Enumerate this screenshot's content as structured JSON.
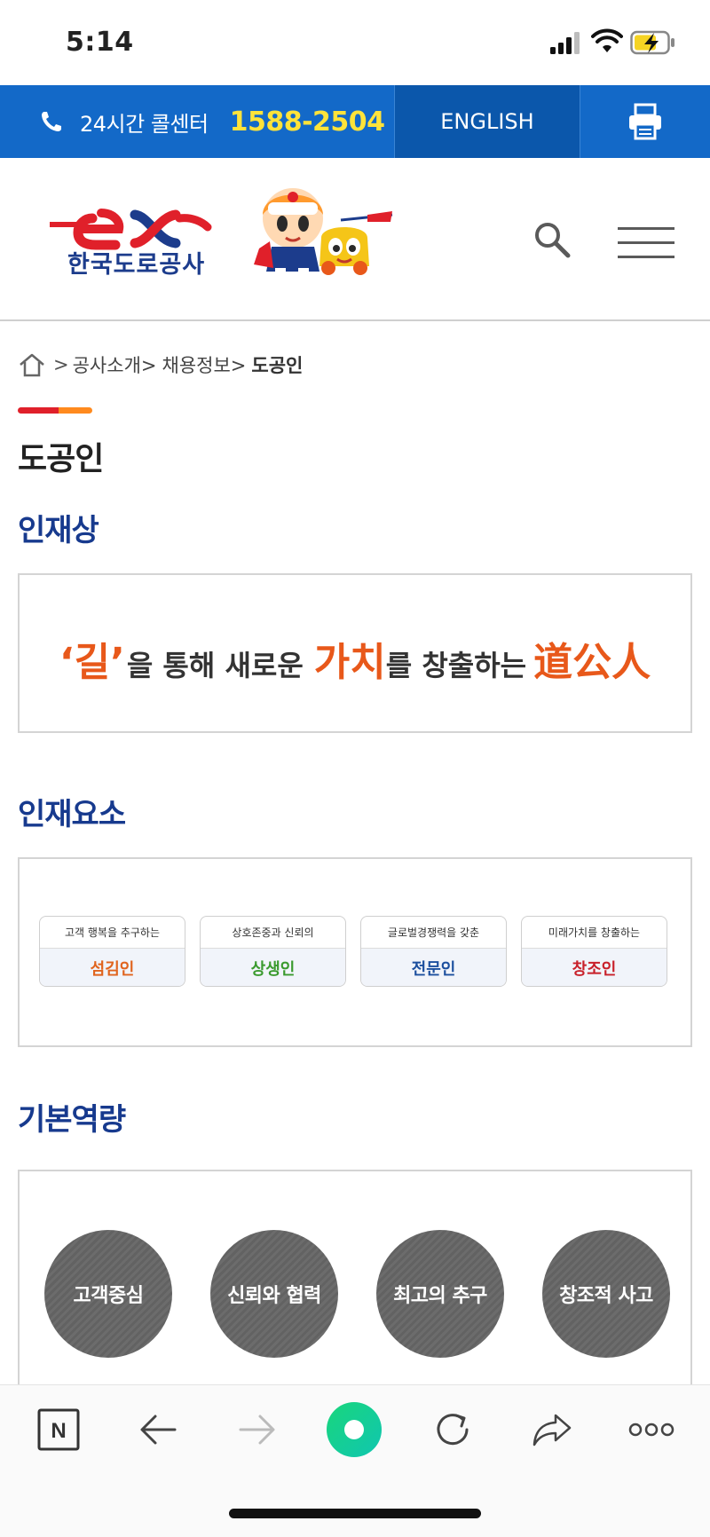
{
  "status_bar": {
    "time": "5:14"
  },
  "top_bar": {
    "call_label": "24시간 콜센터",
    "call_number": "1588-2504",
    "english_label": "ENGLISH"
  },
  "header": {
    "logo_mark": "ex",
    "logo_text": "한국도로공사"
  },
  "breadcrumb": {
    "items": [
      "공사소개>",
      "채용정보>"
    ],
    "current": "도공인",
    "separator": ">"
  },
  "page_title": "도공인",
  "sections": {
    "ideal": {
      "title": "인재상",
      "slogan": {
        "part1": "‘길’",
        "part2": "을 통해 새로운",
        "part3": "가치",
        "part4": "를 창출하는",
        "part5": "道公人"
      }
    },
    "elements": {
      "title": "인재요소",
      "cards": [
        {
          "desc": "고객 행복을 추구하는",
          "name": "섬김인",
          "color": "#e0641e"
        },
        {
          "desc": "상호존중과 신뢰의",
          "name": "상생인",
          "color": "#3a9a2e"
        },
        {
          "desc": "글로벌경쟁력을 갖춘",
          "name": "전문인",
          "color": "#1c4f9e"
        },
        {
          "desc": "미래가치를 창출하는",
          "name": "창조인",
          "color": "#c8202a"
        }
      ]
    },
    "competencies": {
      "title": "기본역량",
      "items": [
        "고객중심",
        "신뢰와 협력",
        "최고의 추구",
        "창조적 사고"
      ]
    }
  },
  "colors": {
    "brand_blue": "#1369c8",
    "section_title": "#173a8e",
    "accent_orange": "#e8581a",
    "call_number": "#ffe33a"
  },
  "browser_toolbar": {
    "icons": [
      "naver-n-icon",
      "back-arrow-icon",
      "forward-arrow-icon",
      "home-circle-icon",
      "reload-icon",
      "share-icon",
      "more-icon"
    ],
    "naver_label": "N"
  }
}
